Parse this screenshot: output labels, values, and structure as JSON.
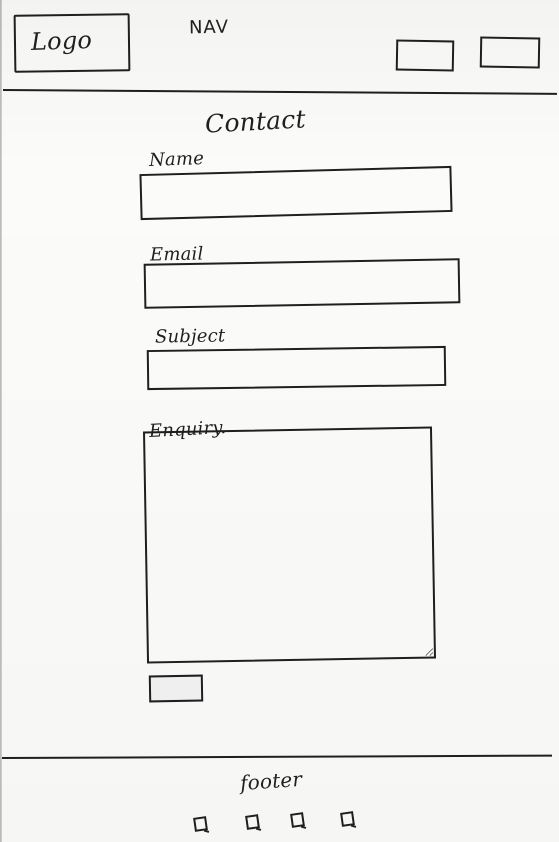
{
  "header": {
    "logo": "Logo",
    "nav": "NAV",
    "nav_icons": [
      "nav-button-1",
      "nav-button-2"
    ]
  },
  "main": {
    "title": "Contact",
    "fields": {
      "name": {
        "label": "Name",
        "value": "",
        "placeholder": ""
      },
      "email": {
        "label": "Email",
        "value": "",
        "placeholder": ""
      },
      "subject": {
        "label": "Subject",
        "value": "",
        "placeholder": ""
      },
      "enquiry": {
        "label": "Enquiry.",
        "value": "",
        "placeholder": ""
      }
    },
    "submit": {
      "label": ""
    }
  },
  "footer": {
    "label": "footer",
    "icons": [
      "social-icon-1",
      "social-icon-2",
      "social-icon-3",
      "social-icon-4"
    ]
  }
}
